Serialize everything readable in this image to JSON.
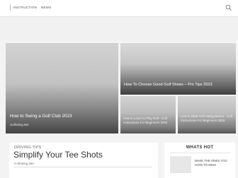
{
  "nav": {
    "items": [
      {
        "label": "INSTRUCTION"
      },
      {
        "label": "NEWS"
      }
    ],
    "search_icon": "search-icon"
  },
  "featured": {
    "main": {
      "title": "How to Swing a Golf Club 2023",
      "source": "Golfrating.Net"
    },
    "top_right": {
      "title": "How To Choose Good Golf Shoes – Pro Tips 2023"
    },
    "small_left": {
      "title": "How to Learn to Play Golf - Golf Instructions For Beginners 2023"
    },
    "small_right": {
      "title": "How to Ideal Golf Swing Basics - Golf Instructions For Beginners 2023"
    }
  },
  "post": {
    "category": "DRIVING TIPS",
    "title": "Simplify Your Tee Shots",
    "source": "Golfrating.Net"
  },
  "sidebar": {
    "widget_title": "WHATS HOT",
    "items": [
      {
        "label": "MAKE THE ONES YOU HATE TO MISS"
      }
    ]
  },
  "colors": {
    "background": "#f3f3f3",
    "topbar": "#ffffff",
    "text_dark": "#333333"
  }
}
